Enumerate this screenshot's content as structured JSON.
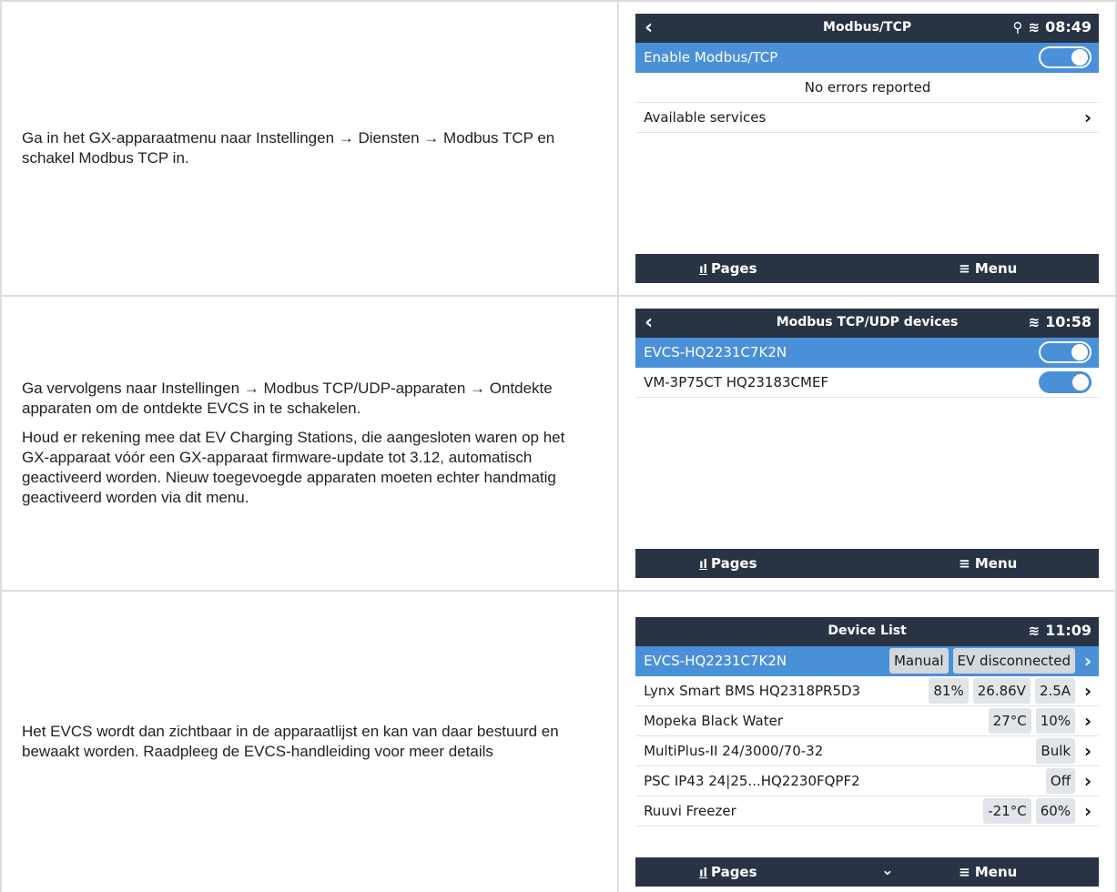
{
  "rows": [
    {
      "text": [
        "Ga in het GX-apparaatmenu naar Instellingen → Diensten → Modbus TCP en schakel Modbus TCP in."
      ],
      "screen": {
        "title": "Modbus/TCP",
        "time": "08:49",
        "items": [
          {
            "label": "Enable Modbus/TCP",
            "control": "switch",
            "on": true,
            "selected": true
          },
          {
            "label": "No errors reported",
            "control": "none",
            "centered": true
          },
          {
            "label": "Available services",
            "control": "chevron"
          }
        ]
      }
    },
    {
      "text": [
        "Ga vervolgens naar Instellingen → Modbus TCP/UDP-apparaten → Ontdekte apparaten om de ontdekte EVCS in te schakelen.",
        "Houd er rekening mee dat EV Charging Stations, die aangesloten waren op het GX-apparaat vóór een GX-apparaat firmware-update tot 3.12, automatisch geactiveerd worden. Nieuw toegevoegde apparaten moeten echter handmatig geactiveerd worden via dit menu."
      ],
      "screen": {
        "title": "Modbus TCP/UDP devices",
        "time": "10:58",
        "items": [
          {
            "label": "EVCS-HQ2231C7K2N",
            "control": "switch",
            "on": true,
            "selected": true
          },
          {
            "label": "VM-3P75CT HQ23183CMEF",
            "control": "switch",
            "on": true
          }
        ]
      }
    },
    {
      "text": [
        "Het EVCS wordt dan zichtbaar in de apparaatlijst en kan van daar bestuurd en bewaakt worden. Raadpleeg de EVCS-handleiding voor meer details"
      ],
      "screen": {
        "title": "Device List",
        "time": "11:09",
        "items": [
          {
            "label": "EVCS-HQ2231C7K2N",
            "values": [
              "Manual",
              "EV disconnected"
            ],
            "selected": true
          },
          {
            "label": "Lynx Smart BMS HQ2318PR5D3",
            "values": [
              "81%",
              "26.86V",
              "2.5A"
            ]
          },
          {
            "label": "Mopeka Black Water",
            "values": [
              "27°C",
              "10%"
            ]
          },
          {
            "label": "MultiPlus-II 24/3000/70-32",
            "values": [
              "Bulk"
            ]
          },
          {
            "label": "PSC IP43 24|25...HQ2230FQPF2",
            "values": [
              "Off"
            ]
          },
          {
            "label": "Ruuvi Freezer",
            "values": [
              "-21°C",
              "60%"
            ]
          }
        ]
      }
    }
  ],
  "footer": {
    "pages": "Pages",
    "menu": "Menu"
  },
  "icons": {
    "back": "chevron-left-icon",
    "location": "location-pin-icon",
    "wifi": "wifi-icon",
    "pages": "bar-chart-icon",
    "menu": "hamburger-icon",
    "down": "chevron-down-icon"
  },
  "colors": {
    "topbar": "#283444",
    "selected": "#4a90d9",
    "switch": "#4a90d9",
    "pill": "#e1e4e8"
  }
}
